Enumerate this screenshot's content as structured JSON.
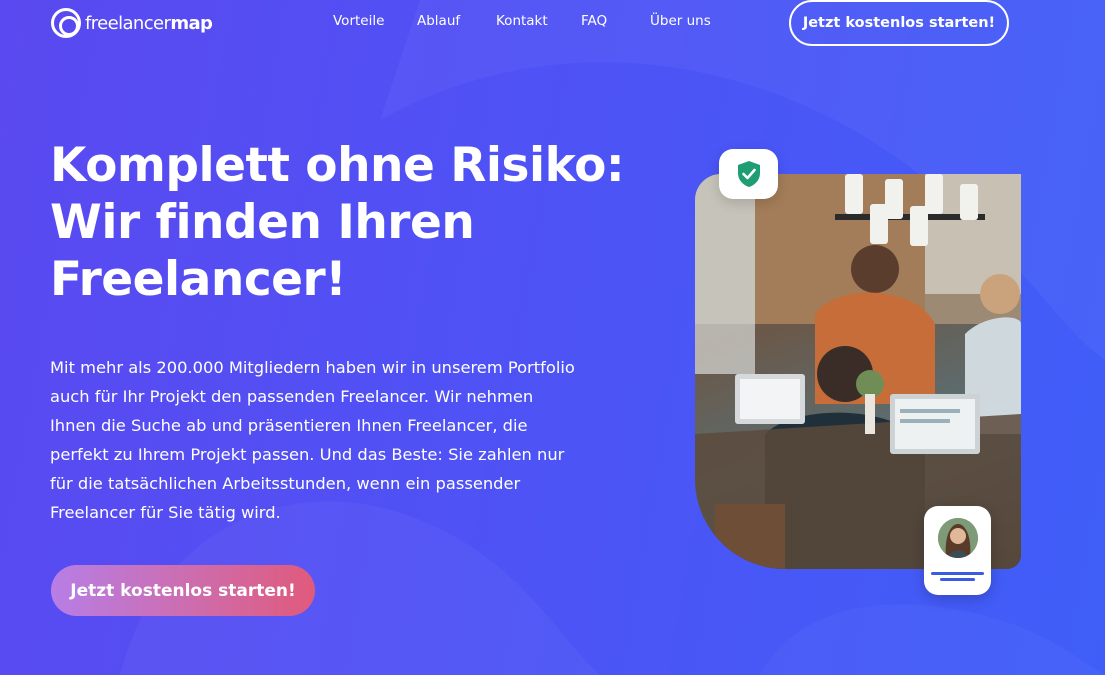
{
  "header": {
    "logo": {
      "part1": "freelancer",
      "part2": "map"
    },
    "nav": [
      {
        "label": "Vorteile"
      },
      {
        "label": "Ablauf"
      },
      {
        "label": "Kontakt"
      },
      {
        "label": "FAQ"
      },
      {
        "label": "Über uns"
      }
    ],
    "cta_label": "Jetzt kostenlos starten!"
  },
  "hero": {
    "title_lines": [
      "Komplett ohne Risiko:",
      "Wir finden Ihren",
      "Freelancer!"
    ],
    "text_lines": [
      "Mit mehr als 200.000 Mitgliedern haben wir in unserem Portfolio",
      "auch für Ihr Projekt den passenden Freelancer. Wir nehmen",
      "Ihnen die Suche ab und präsentieren Ihnen Freelancer, die",
      "perfekt zu Ihrem Projekt passen. Und das Beste:  Sie zahlen nur",
      "für die tatsächlichen Arbeitsstunden, wenn ein passender",
      "Freelancer für Sie tätig wird."
    ],
    "cta_label": "Jetzt kostenlos starten!"
  },
  "icons": {
    "shield": "shield-check-icon",
    "avatar": "user-avatar"
  },
  "colors": {
    "background_start": "#5a49f0",
    "background_end": "#3f5ef8",
    "cta_gradient_start": "#b77ee6",
    "cta_gradient_end": "#e05a7c",
    "shield_green": "#1f9e73",
    "card_line": "#3b5be0"
  }
}
